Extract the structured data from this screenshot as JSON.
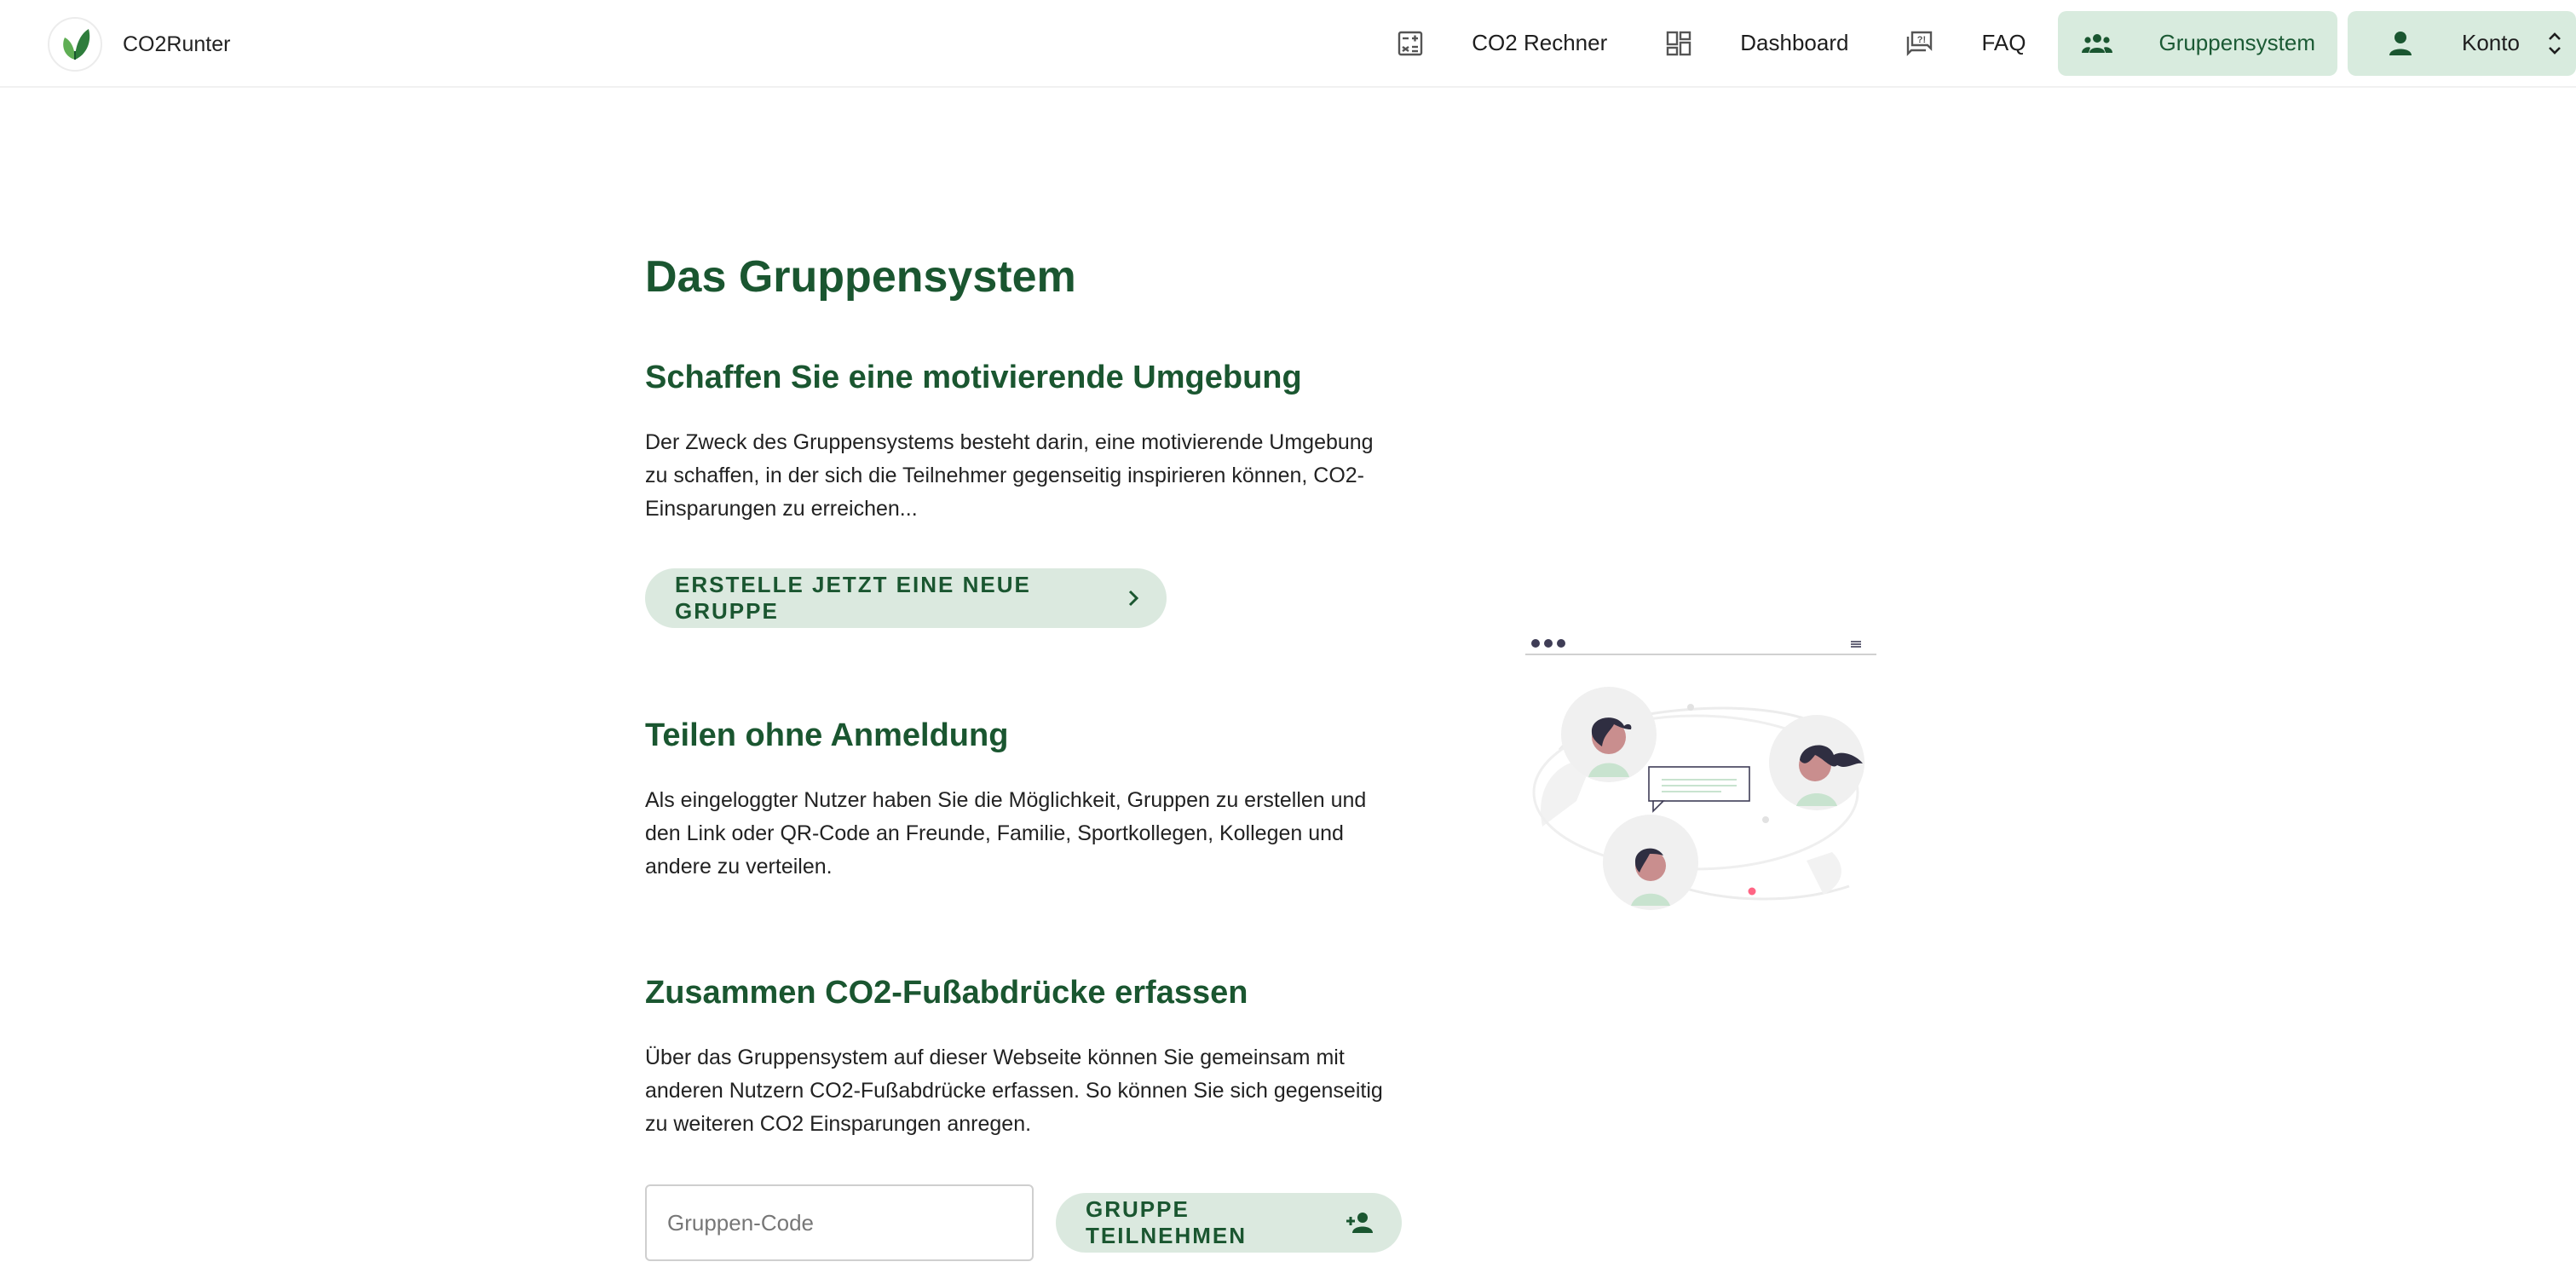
{
  "app": {
    "name": "CO2Runter"
  },
  "nav": {
    "items": [
      {
        "label": "CO2 Rechner",
        "icon": "calculator-icon"
      },
      {
        "label": "Dashboard",
        "icon": "dashboard-icon"
      },
      {
        "label": "FAQ",
        "icon": "faq-icon"
      },
      {
        "label": "Gruppensystem",
        "icon": "group-icon",
        "active": true
      },
      {
        "label": "Konto",
        "icon": "person-icon"
      }
    ]
  },
  "page": {
    "title": "Das Gruppensystem",
    "sections": [
      {
        "heading": "Schaffen Sie eine motivierende Umgebung",
        "text": "Der Zweck des Gruppensystems besteht darin, eine motivierende Umgebung zu schaffen, in der sich die Teilnehmer gegenseitig inspirieren können, CO2-Einsparungen zu erreichen..."
      },
      {
        "heading": "Teilen ohne Anmeldung",
        "text": "Als eingeloggter Nutzer haben Sie die Möglichkeit, Gruppen zu erstellen und den Link oder QR-Code an Freunde, Familie, Sportkollegen, Kollegen und andere zu verteilen."
      },
      {
        "heading": "Zusammen CO2-Fußabdrücke erfassen",
        "text": "Über das Gruppensystem auf dieser Webseite können Sie gemeinsam mit anderen Nutzern CO2-Fußabdrücke erfassen. So können Sie sich gegenseitig zu weiteren CO2 Einsparungen anregen."
      }
    ],
    "create_button": "ERSTELLE JETZT EINE NEUE GRUPPE",
    "join": {
      "placeholder": "Gruppen-Code",
      "value": "",
      "button": "GRUPPE TEILNEHMEN"
    }
  },
  "colors": {
    "accent": "#1a5630",
    "button_bg": "#d8ebde",
    "text": "#222222"
  }
}
